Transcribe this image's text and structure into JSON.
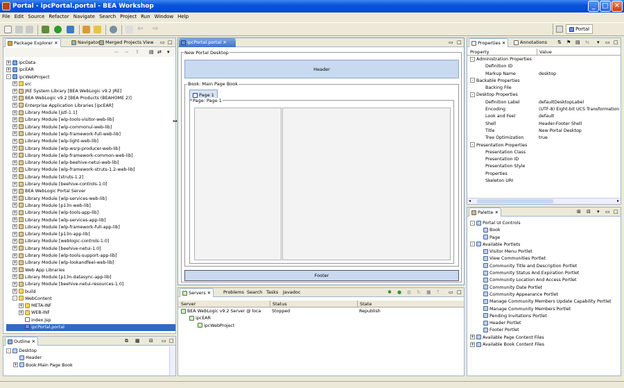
{
  "window": {
    "title": "Portal - ipcPortal.portal - BEA Workshop"
  },
  "menu": [
    "File",
    "Edit",
    "Source",
    "Refactor",
    "Navigate",
    "Search",
    "Project",
    "Run",
    "Window",
    "Help"
  ],
  "perspective": {
    "label": "Portal"
  },
  "explorer": {
    "tabs": [
      "Package Explorer",
      "Navigator",
      "Merged Projects View"
    ],
    "items": [
      {
        "label": "ipcData",
        "kind": "proj",
        "depth": 0,
        "exp": "+"
      },
      {
        "label": "ipcEAR",
        "kind": "proj",
        "depth": 0,
        "exp": "+"
      },
      {
        "label": "ipcWebProject",
        "kind": "proj",
        "depth": 0,
        "exp": "-"
      },
      {
        "label": "src",
        "kind": "folder",
        "depth": 1,
        "exp": "+"
      },
      {
        "label": "JRE System Library [BEA WebLogic v9.2 JRE]",
        "kind": "jar",
        "depth": 1,
        "exp": "+"
      },
      {
        "label": "BEA WebLogic v9.2 [BEA Products (BEAHOME 2)]",
        "kind": "jar",
        "depth": 1,
        "exp": "+"
      },
      {
        "label": "Enterprise Application Libraries [ipcEAR]",
        "kind": "jar",
        "depth": 1,
        "exp": "+"
      },
      {
        "label": "Library Module [jstl-1.1]",
        "kind": "jar",
        "depth": 1,
        "exp": "+"
      },
      {
        "label": "Library Module [wlp-tools-visitor-web-lib]",
        "kind": "jar",
        "depth": 1,
        "exp": "+"
      },
      {
        "label": "Library Module [wlp-commonui-web-lib]",
        "kind": "jar",
        "depth": 1,
        "exp": "+"
      },
      {
        "label": "Library Module [wlp-framework-full-web-lib]",
        "kind": "jar",
        "depth": 1,
        "exp": "+"
      },
      {
        "label": "Library Module [wlp-light-web-lib]",
        "kind": "jar",
        "depth": 1,
        "exp": "+"
      },
      {
        "label": "Library Module [wlp-wsrp-producer-web-lib]",
        "kind": "jar",
        "depth": 1,
        "exp": "+"
      },
      {
        "label": "Library Module [wlp-framework-common-web-lib]",
        "kind": "jar",
        "depth": 1,
        "exp": "+"
      },
      {
        "label": "Library Module [wlp-beehive-netui-web-lib]",
        "kind": "jar",
        "depth": 1,
        "exp": "+"
      },
      {
        "label": "Library Module [wlp-framework-struts-1.2-web-lib]",
        "kind": "jar",
        "depth": 1,
        "exp": "+"
      },
      {
        "label": "Library Module [struts-1.2]",
        "kind": "jar",
        "depth": 1,
        "exp": "+"
      },
      {
        "label": "Library Module [beehive-controls-1.0]",
        "kind": "jar",
        "depth": 1,
        "exp": "+"
      },
      {
        "label": "BEA WebLogic Portal Server",
        "kind": "jar",
        "depth": 1,
        "exp": "+"
      },
      {
        "label": "Library Module [wlp-services-web-lib]",
        "kind": "jar",
        "depth": 1,
        "exp": "+"
      },
      {
        "label": "Library Module [p13n-web-lib]",
        "kind": "jar",
        "depth": 1,
        "exp": "+"
      },
      {
        "label": "Library Module [wlp-tools-app-lib]",
        "kind": "jar",
        "depth": 1,
        "exp": "+"
      },
      {
        "label": "Library Module [wlp-services-app-lib]",
        "kind": "jar",
        "depth": 1,
        "exp": "+"
      },
      {
        "label": "Library Module [wlp-framework-full-app-lib]",
        "kind": "jar",
        "depth": 1,
        "exp": "+"
      },
      {
        "label": "Library Module [p13n-app-lib]",
        "kind": "jar",
        "depth": 1,
        "exp": "+"
      },
      {
        "label": "Library Module [weblogic-controls-1.0]",
        "kind": "jar",
        "depth": 1,
        "exp": "+"
      },
      {
        "label": "Library Module [beehive-netui-1.0]",
        "kind": "jar",
        "depth": 1,
        "exp": "+"
      },
      {
        "label": "Library Module [wlp-tools-support-app-lib]",
        "kind": "jar",
        "depth": 1,
        "exp": "+"
      },
      {
        "label": "Library Module [wlp-lookandfeel-web-lib]",
        "kind": "jar",
        "depth": 1,
        "exp": "+"
      },
      {
        "label": "Web App Libraries",
        "kind": "jar",
        "depth": 1,
        "exp": "+"
      },
      {
        "label": "Library Module [p13n-datasync-app-lib]",
        "kind": "jar",
        "depth": 1,
        "exp": "+"
      },
      {
        "label": "Library Module [beehive-netui-resources-1.0]",
        "kind": "jar",
        "depth": 1,
        "exp": "+"
      },
      {
        "label": "build",
        "kind": "folder",
        "depth": 1,
        "exp": "+"
      },
      {
        "label": "WebContent",
        "kind": "folder",
        "depth": 1,
        "exp": "-"
      },
      {
        "label": "META-INF",
        "kind": "folder",
        "depth": 2,
        "exp": "+"
      },
      {
        "label": "WEB-INF",
        "kind": "folder",
        "depth": 2,
        "exp": "+"
      },
      {
        "label": "index.jsp",
        "kind": "file",
        "depth": 2,
        "exp": ""
      },
      {
        "label": "ipcPortal.portal",
        "kind": "portal",
        "depth": 2,
        "exp": "",
        "selected": true
      }
    ]
  },
  "outline": {
    "tab": "Outline",
    "items": [
      {
        "label": "Desktop",
        "depth": 0,
        "exp": "-"
      },
      {
        "label": "Header",
        "depth": 1,
        "exp": ""
      },
      {
        "label": "Book:Main Page Book",
        "depth": 1,
        "exp": "+"
      }
    ]
  },
  "editor": {
    "tab": "ipcPortal.portal",
    "desktop_label": "New Portal Desktop",
    "header": "Header",
    "book_label": "Book: Main Page Book",
    "page_tab": "Page 1",
    "page_label": "Page: Page 1",
    "footer": "Footer"
  },
  "servers": {
    "tabs": [
      "Servers",
      "Problems",
      "Search",
      "Tasks",
      "Javadoc"
    ],
    "columns": [
      "Server",
      "Status",
      "State"
    ],
    "rows": [
      {
        "server": "BEA WebLogic v9.2 Server @ loca",
        "status": "Stopped",
        "state": "Republish",
        "depth": 0
      },
      {
        "server": "ipcEAR",
        "status": "",
        "state": "",
        "depth": 1
      },
      {
        "server": "ipcWebProject",
        "status": "",
        "state": "",
        "depth": 2
      }
    ]
  },
  "properties": {
    "tabs": [
      "Properties",
      "Annotations"
    ],
    "columns": [
      "Property",
      "Value"
    ],
    "rows": [
      {
        "name": "Administration Properties",
        "value": "",
        "group": true
      },
      {
        "name": "Definition ID",
        "value": ""
      },
      {
        "name": "Markup Name",
        "value": "desktop"
      },
      {
        "name": "Backable Properties",
        "value": "",
        "group": true
      },
      {
        "name": "Backing File",
        "value": ""
      },
      {
        "name": "Desktop Properties",
        "value": "",
        "group": true
      },
      {
        "name": "Definition Label",
        "value": "defaultDesktopLabel"
      },
      {
        "name": "Encoding",
        "value": "(UTF-8) Eight-bit UCS Transformation"
      },
      {
        "name": "Look and Feel",
        "value": "default"
      },
      {
        "name": "Shell",
        "value": "Header-Footer Shell"
      },
      {
        "name": "Title",
        "value": "New Portal Desktop"
      },
      {
        "name": "Tree Optimization",
        "value": "true"
      },
      {
        "name": "Presentation Properties",
        "value": "",
        "group": true
      },
      {
        "name": "Presentation Class",
        "value": ""
      },
      {
        "name": "Presentation ID",
        "value": ""
      },
      {
        "name": "Presentation Style",
        "value": ""
      },
      {
        "name": "Properties",
        "value": ""
      },
      {
        "name": "Skeleton URI",
        "value": ""
      }
    ]
  },
  "palette": {
    "tab": "Palette",
    "items": [
      {
        "label": "Portal UI Controls",
        "depth": 0,
        "exp": "-"
      },
      {
        "label": "Book",
        "depth": 1,
        "exp": ""
      },
      {
        "label": "Page",
        "depth": 1,
        "exp": ""
      },
      {
        "label": "Available Portlets",
        "depth": 0,
        "exp": "-"
      },
      {
        "label": "Visitor Menu Portlet",
        "depth": 1,
        "exp": ""
      },
      {
        "label": "View Communities Portlet",
        "depth": 1,
        "exp": ""
      },
      {
        "label": "Community Title and Description Portlet",
        "depth": 1,
        "exp": ""
      },
      {
        "label": "Community Status And Expiration Portlet",
        "depth": 1,
        "exp": ""
      },
      {
        "label": "Community Location And Access Portlet",
        "depth": 1,
        "exp": ""
      },
      {
        "label": "Community Date Portlet",
        "depth": 1,
        "exp": ""
      },
      {
        "label": "Community Appearance Portlet",
        "depth": 1,
        "exp": ""
      },
      {
        "label": "Manage Community Members Update Capability Portlet",
        "depth": 1,
        "exp": ""
      },
      {
        "label": "Manage Community Members Portlet",
        "depth": 1,
        "exp": ""
      },
      {
        "label": "Pending Invitations Portlet",
        "depth": 1,
        "exp": ""
      },
      {
        "label": "Header Portlet",
        "depth": 1,
        "exp": ""
      },
      {
        "label": "Footer Portlet",
        "depth": 1,
        "exp": ""
      },
      {
        "label": "Available Page Content Files",
        "depth": 0,
        "exp": "+"
      },
      {
        "label": "Available Book Content Files",
        "depth": 0,
        "exp": "+"
      }
    ]
  }
}
